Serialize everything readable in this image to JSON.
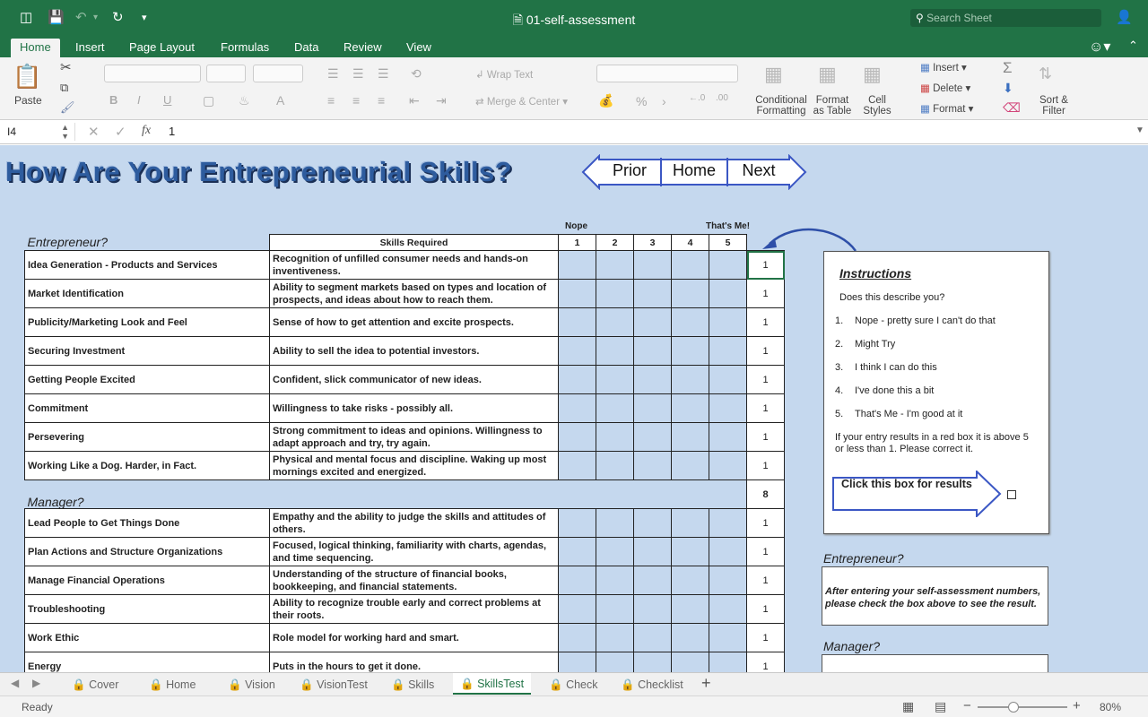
{
  "titlebar": {
    "doc_title": "01-self-assessment",
    "search_placeholder": "Search Sheet"
  },
  "ribbon_tabs": [
    "Home",
    "Insert",
    "Page Layout",
    "Formulas",
    "Data",
    "Review",
    "View"
  ],
  "ribbon": {
    "paste": "Paste",
    "wrap_text": "Wrap Text",
    "merge_center": "Merge & Center",
    "conditional_formatting": [
      "Conditional",
      "Formatting"
    ],
    "format_as_table": [
      "Format",
      "as Table"
    ],
    "cell_styles": [
      "Cell",
      "Styles"
    ],
    "insert": "Insert",
    "delete": "Delete",
    "format": "Format",
    "sort_filter": [
      "Sort &",
      "Filter"
    ]
  },
  "formula_bar": {
    "cell_ref": "I4",
    "formula": "1"
  },
  "sheet": {
    "title": "How Are Your Entrepreneurial Skills?",
    "nav": {
      "prior": "Prior",
      "home": "Home",
      "next": "Next"
    },
    "scale_labels": {
      "low": "Nope",
      "high": "That's Me!"
    },
    "headers": {
      "skills": "Skills Required",
      "cols": [
        "1",
        "2",
        "3",
        "4",
        "5"
      ]
    },
    "entrepreneur": {
      "label": "Entrepreneur?",
      "rows": [
        {
          "name": "Idea Generation - Products and Services",
          "skill": "Recognition of unfilled consumer needs and hands-on inventiveness.",
          "value": "1"
        },
        {
          "name": "Market Identification",
          "skill": "Ability to segment markets based on types and location of prospects, and ideas about how to reach them.",
          "value": "1"
        },
        {
          "name": "Publicity/Marketing Look and Feel",
          "skill": "Sense of how to get attention and excite prospects.",
          "value": "1"
        },
        {
          "name": "Securing Investment",
          "skill": "Ability to sell the idea to potential investors.",
          "value": "1"
        },
        {
          "name": "Getting People Excited",
          "skill": "Confident, slick communicator of new ideas.",
          "value": "1"
        },
        {
          "name": "Commitment",
          "skill": "Willingness to take risks - possibly all.",
          "value": "1"
        },
        {
          "name": "Persevering",
          "skill": "Strong commitment to ideas and opinions. Willingness to adapt approach and try, try again.",
          "value": "1"
        },
        {
          "name": "Working Like a Dog. Harder, in Fact.",
          "skill": "Physical and mental focus and discipline. Waking up most mornings excited and energized.",
          "value": "1"
        }
      ],
      "total": "8"
    },
    "manager": {
      "label": "Manager?",
      "rows": [
        {
          "name": "Lead People to Get Things Done",
          "skill": "Empathy and the ability to judge the skills and attitudes of others.",
          "value": "1"
        },
        {
          "name": "Plan Actions and Structure Organizations",
          "skill": "Focused, logical thinking, familiarity with charts, agendas, and time sequencing.",
          "value": "1"
        },
        {
          "name": "Manage Financial Operations",
          "skill": "Understanding of the structure of financial books, bookkeeping, and financial statements.",
          "value": "1"
        },
        {
          "name": "Troubleshooting",
          "skill": "Ability to recognize trouble early and correct problems at their roots.",
          "value": "1"
        },
        {
          "name": "Work Ethic",
          "skill": "Role model for working hard and smart.",
          "value": "1"
        },
        {
          "name": "Energy",
          "skill": "Puts in the hours to get it done.",
          "value": "1"
        }
      ]
    },
    "instructions": {
      "heading": "Instructions",
      "question": "Does this describe you?",
      "options": [
        {
          "num": "1.",
          "text": "Nope - pretty sure I can't do that"
        },
        {
          "num": "2.",
          "text": "Might Try"
        },
        {
          "num": "3.",
          "text": "I think I can do this"
        },
        {
          "num": "4.",
          "text": "I've done this a bit"
        },
        {
          "num": "5.",
          "text": "That's Me - I'm good at it"
        }
      ],
      "note": "If your entry results in a red box it is above 5 or less than 1. Please correct it.",
      "click_label": "Click this box for results"
    },
    "side_entrepreneur": {
      "label": "Entrepreneur?",
      "message": "After entering your self-assessment numbers, please check the box above to see the result."
    },
    "side_manager": {
      "label": "Manager?"
    }
  },
  "sheet_tabs": [
    "Cover",
    "Home",
    "Vision",
    "VisionTest",
    "Skills",
    "SkillsTest",
    "Check",
    "Checklist"
  ],
  "active_sheet": "SkillsTest",
  "status": {
    "mode": "Ready",
    "zoom": "80%"
  },
  "colors": {
    "excel_green": "#217346",
    "sheet_bg": "#c5d8ee",
    "nav_blue": "#3b57c4"
  }
}
